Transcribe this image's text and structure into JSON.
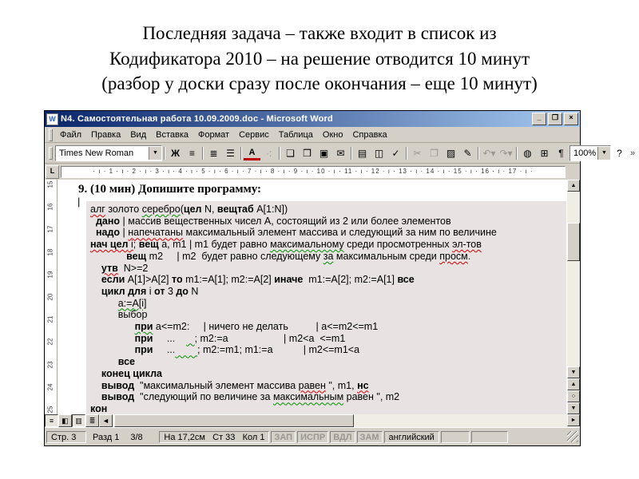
{
  "colors": {
    "titlebar_gradient_start": "#0a246a",
    "titlebar_gradient_end": "#a6caf0",
    "chrome": "#d4d0c8",
    "code_background": "#e8e2e2",
    "spell_error": "#d00000",
    "grammar_error": "#009000"
  },
  "slide": {
    "title_lines": [
      "Последняя задача – также входит в список из",
      "Кодификатора 2010 – на решение отводится 10 минут",
      "(разбор у доски сразу после окончания – еще 10 минут)"
    ]
  },
  "icons": {
    "word_icon": "W",
    "minimize": "_",
    "maximize": "❐",
    "close": "×",
    "dropdown": "▼",
    "scroll_up": "▲",
    "scroll_down": "▼",
    "scroll_left": "◄",
    "scroll_right": "►",
    "prev_page": "▲",
    "browse_object": "○",
    "next_page": "▼",
    "tab_selector": "L",
    "help": "?",
    "chevron": "»"
  },
  "window": {
    "title": "N4. Самостоятельная работа 10.09.2009.doc - Microsoft Word",
    "menu": [
      "Файл",
      "Правка",
      "Вид",
      "Вставка",
      "Формат",
      "Сервис",
      "Таблица",
      "Окно",
      "Справка"
    ],
    "toolbar": {
      "font_name": "Times New Roman",
      "zoom_level": "100%",
      "buttons": [
        {
          "name": "bold-button",
          "glyph": "Ж",
          "cls": "bld"
        },
        {
          "name": "align-left-button",
          "glyph": "≡"
        },
        {
          "sep": true
        },
        {
          "name": "numbering-button",
          "glyph": "≣"
        },
        {
          "name": "bullets-button",
          "glyph": "☰"
        },
        {
          "sep": true
        },
        {
          "name": "font-color-button",
          "glyph": "A",
          "cls": "fontcolor"
        },
        {
          "name": "more-format-button",
          "glyph": "·:",
          "cls": "dim"
        },
        {
          "sep": true
        },
        {
          "name": "new-document-button",
          "glyph": "❏"
        },
        {
          "name": "open-button",
          "glyph": "❒"
        },
        {
          "name": "save-button",
          "glyph": "▣"
        },
        {
          "name": "mail-button",
          "glyph": "✉"
        },
        {
          "sep": true
        },
        {
          "name": "print-button",
          "glyph": "▤"
        },
        {
          "name": "print-preview-button",
          "glyph": "◫"
        },
        {
          "name": "spelling-button",
          "glyph": "✓"
        },
        {
          "sep": true
        },
        {
          "name": "cut-button",
          "glyph": "✂",
          "cls": "dim"
        },
        {
          "name": "copy-button",
          "glyph": "❐",
          "cls": "dim"
        },
        {
          "name": "paste-button",
          "glyph": "▨"
        },
        {
          "name": "format-painter-button",
          "glyph": "✎"
        },
        {
          "sep": true
        },
        {
          "name": "undo-button",
          "glyph": "↶▾",
          "cls": "dim"
        },
        {
          "name": "redo-button",
          "glyph": "↷▾",
          "cls": "dim"
        },
        {
          "sep": true
        },
        {
          "name": "insert-hyperlink-button",
          "glyph": "◍"
        },
        {
          "name": "tables-borders-button",
          "glyph": "⊞"
        },
        {
          "name": "show-paragraph-marks-button",
          "glyph": "¶"
        }
      ]
    },
    "ruler_h": [
      1,
      2,
      3,
      4,
      5,
      6,
      7,
      8,
      9,
      10,
      11,
      12,
      13,
      14,
      15,
      16,
      17
    ],
    "ruler_v": [
      15,
      16,
      17,
      18,
      19,
      20,
      21,
      22,
      23,
      24,
      25
    ],
    "view_buttons": [
      {
        "name": "normal-view-button",
        "glyph": "≡",
        "on": true
      },
      {
        "name": "web-layout-view-button",
        "glyph": "◧",
        "on": false
      },
      {
        "name": "print-layout-view-button",
        "glyph": "▥",
        "on": true
      },
      {
        "name": "outline-view-button",
        "glyph": "≣",
        "on": false
      },
      {
        "name": "scroll-left-button",
        "glyph": "◄",
        "on": false
      }
    ],
    "doc": {
      "heading": "9. (10 мин) Допишите программу:",
      "cursor": "|",
      "code_lines": [
        "~алг~ золото `серебро`(**цел** N, **вещтаб** A[1:N])",
        "  **дано** | массив вещественных чисел A, состоящий из 2 или более элементов",
        "  **надо** | ~напечатаны~ максимальный элемент массива и следующий за ним по величине",
        "~**нач цел** i~; **вещ** a, m1 | m1 будет равно `максимальному` среди просмотренных ~эл-тов~",
        "             **вещ** m2     | m2  будет равно следующему `за` максимальным среди ~просм~.",
        "    ~**утв**~  N>=2",
        "    **если** A[1]>A[2] **то** m1:=A[1]; m2:=A[2] **иначе**  m1:=A[2]; m2:=A[1] **все**",
        "    **цикл для** i **от** 3 **до** N",
        "          `a:=A[i]`",
        "          выбор",
        "                **`при`** a<=m2:     | ничего не делать          | a<=m2<=m1",
        "                **при**     ...    `   `; m2:=a                    | m2<a  <=m1",
        "                **при**     ...`        `; m2:=m1; m1:=a           | m2<=m1<a",
        "          **все**",
        "    **конец цикла**",
        "    **вывод**  \"максимальный элемент массива ~равен~ \", m1, **~нс~**",
        "    **вывод**  \"следующий по величине за `максимальным` равен \", m2",
        "**кон**"
      ]
    },
    "status": {
      "page": "Стр. 3",
      "section": "Разд 1",
      "page_of": "3/8",
      "at": "На 17,2см",
      "line": "Ст 33",
      "column": "Кол 1",
      "modes": [
        "ЗАП",
        "ИСПР",
        "ВДЛ",
        "ЗАМ"
      ],
      "language": "английский"
    }
  }
}
